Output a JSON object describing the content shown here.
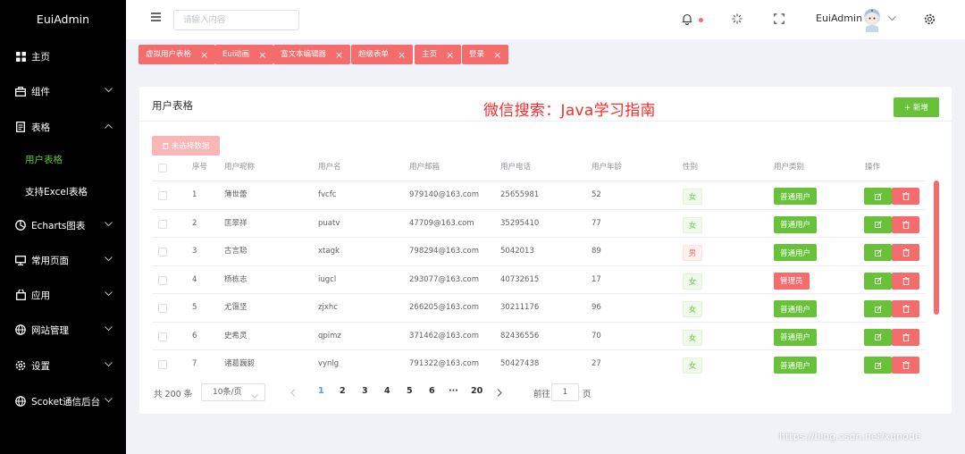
{
  "sidebar": {
    "brand": "EuiAdmin",
    "items": [
      {
        "label": "主页",
        "icon": "grid-icon"
      },
      {
        "label": "组件",
        "icon": "briefcase-icon"
      },
      {
        "label": "表格",
        "icon": "document-icon"
      },
      {
        "label": "Echarts图表",
        "icon": "pie-chart-icon"
      },
      {
        "label": "常用页面",
        "icon": "monitor-icon"
      },
      {
        "label": "应用",
        "icon": "bag-icon"
      },
      {
        "label": "网站管理",
        "icon": "globe-icon"
      },
      {
        "label": "设置",
        "icon": "gear-icon"
      },
      {
        "label": "Scoket通信后台",
        "icon": "globe-icon"
      }
    ],
    "table_sub": [
      {
        "label": "用户表格",
        "active": true
      },
      {
        "label": "支持Excel表格",
        "active": false
      }
    ]
  },
  "header": {
    "search_placeholder": "请输入内容",
    "username": "EuiAdmin"
  },
  "tags": [
    "虚拟用户表格",
    "Eui动画",
    "富文本编辑器",
    "超级表单",
    "主页",
    "登录"
  ],
  "card": {
    "title": "用户表格",
    "watermark": "微信搜索：Java学习指南",
    "add_label": "+ 新增",
    "selected_label": "未选择数据"
  },
  "table": {
    "columns": [
      "序号",
      "用户昵称",
      "用户名",
      "用户邮箱",
      "用户电话",
      "用户年龄",
      "性别",
      "用户类别",
      "操作"
    ],
    "rows": [
      {
        "no": "1",
        "nickname": "薄世蕾",
        "username": "fvcfc",
        "email": "979140@163.com",
        "phone": "25655981",
        "age": "52",
        "gender": "女",
        "type": "普通用户"
      },
      {
        "no": "2",
        "nickname": "匡翠祥",
        "username": "puatv",
        "email": "47709@163.com",
        "phone": "35295410",
        "age": "77",
        "gender": "女",
        "type": "普通用户"
      },
      {
        "no": "3",
        "nickname": "古言聪",
        "username": "xtagk",
        "email": "798294@163.com",
        "phone": "5042013",
        "age": "89",
        "gender": "男",
        "type": "普通用户"
      },
      {
        "no": "4",
        "nickname": "杨栋志",
        "username": "iugcl",
        "email": "293077@163.com",
        "phone": "40732615",
        "age": "17",
        "gender": "女",
        "type": "管理员"
      },
      {
        "no": "5",
        "nickname": "尤霭坚",
        "username": "zjxhc",
        "email": "266205@163.com",
        "phone": "30211176",
        "age": "96",
        "gender": "女",
        "type": "普通用户"
      },
      {
        "no": "6",
        "nickname": "史希灵",
        "username": "qpimz",
        "email": "371462@163.com",
        "phone": "82436556",
        "age": "70",
        "gender": "女",
        "type": "普通用户"
      },
      {
        "no": "7",
        "nickname": "诸葛巍毅",
        "username": "vynlg",
        "email": "791322@163.com",
        "phone": "50427438",
        "age": "27",
        "gender": "女",
        "type": "普通用户"
      }
    ]
  },
  "pagination": {
    "total": "共 200 条",
    "page_size": "10条/页",
    "pages": [
      "1",
      "2",
      "3",
      "4",
      "5",
      "6",
      "···",
      "20"
    ],
    "current": "1",
    "goto_label": "前往",
    "goto_value": "1",
    "page_label": "页"
  },
  "credit": "https://blog.csdn.net/xqnode",
  "colors": {
    "accent_green": "#67c23a",
    "accent_red": "#f56c6c",
    "active_blue": "#409eff",
    "watermark_red": "#ff2a2a"
  }
}
